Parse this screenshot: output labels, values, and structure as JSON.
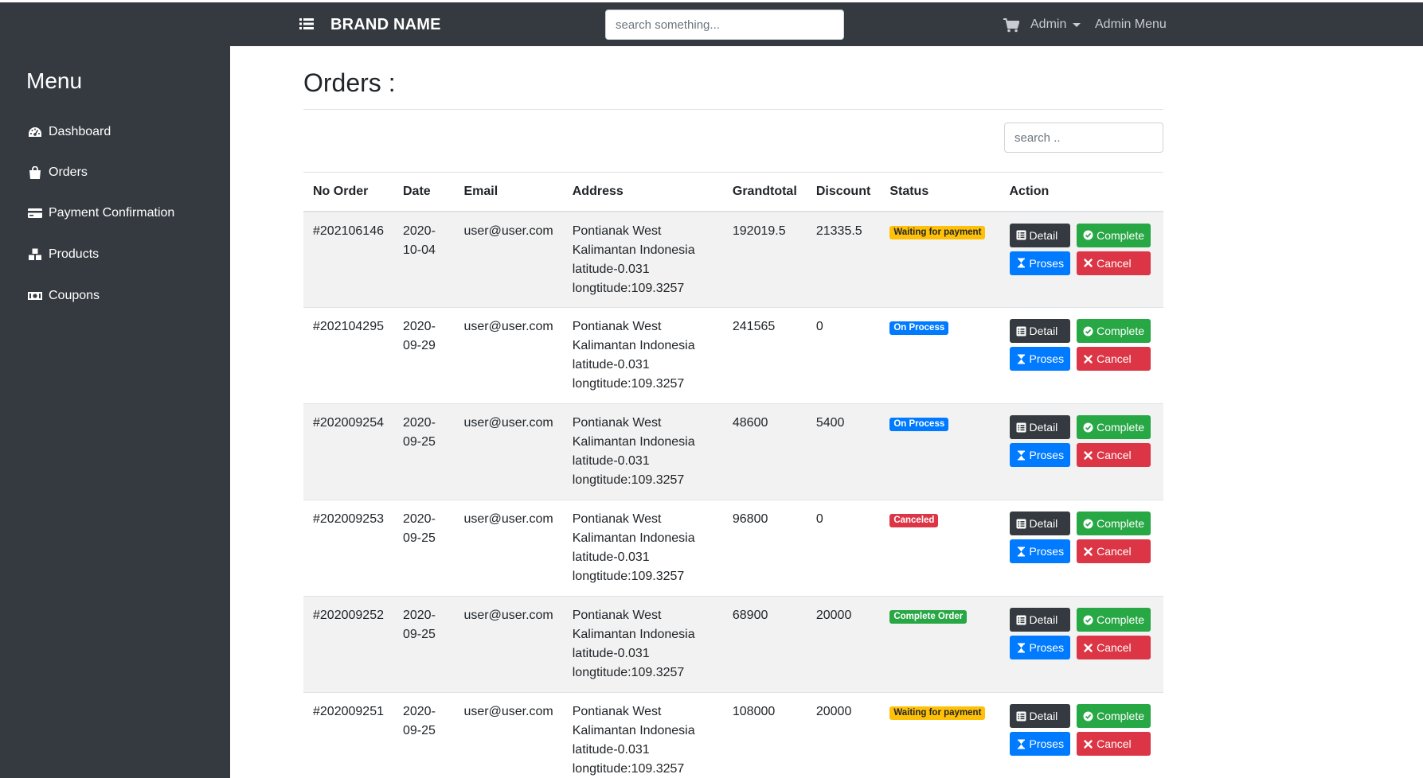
{
  "navbar": {
    "brand": "BRAND NAME",
    "search_placeholder": "search something...",
    "admin_label": "Admin",
    "admin_menu_label": "Admin Menu"
  },
  "sidebar": {
    "title": "Menu",
    "items": [
      {
        "label": "Dashboard",
        "icon": "tachometer-icon"
      },
      {
        "label": "Orders",
        "icon": "shopping-bag-icon"
      },
      {
        "label": "Payment Confirmation",
        "icon": "credit-card-icon"
      },
      {
        "label": "Products",
        "icon": "cubes-icon"
      },
      {
        "label": "Coupons",
        "icon": "money-bill-icon"
      }
    ]
  },
  "page": {
    "title": "Orders :",
    "search_placeholder": "search .."
  },
  "table": {
    "headers": [
      "No Order",
      "Date",
      "Email",
      "Address",
      "Grandtotal",
      "Discount",
      "Status",
      "Action"
    ],
    "actions": {
      "detail": "Detail",
      "complete": "Complete",
      "proses": "Proses",
      "cancel": "Cancel"
    },
    "rows": [
      {
        "no": "#202106146",
        "date": "2020-10-04",
        "email": "user@user.com",
        "addr1": "Pontianak West",
        "addr2": "Kalimantan Indonesia",
        "addr3": "latitude-0.031",
        "addr4": "longtitude:109.3257",
        "total": "192019.5",
        "discount": "21335.5",
        "status": "Waiting for payment"
      },
      {
        "no": "#202104295",
        "date": "2020-09-29",
        "email": "user@user.com",
        "addr1": "Pontianak West",
        "addr2": "Kalimantan Indonesia",
        "addr3": "latitude-0.031",
        "addr4": "longtitude:109.3257",
        "total": "241565",
        "discount": "0",
        "status": "On Process"
      },
      {
        "no": "#202009254",
        "date": "2020-09-25",
        "email": "user@user.com",
        "addr1": "Pontianak West",
        "addr2": "Kalimantan Indonesia",
        "addr3": "latitude-0.031",
        "addr4": "longtitude:109.3257",
        "total": "48600",
        "discount": "5400",
        "status": "On Process"
      },
      {
        "no": "#202009253",
        "date": "2020-09-25",
        "email": "user@user.com",
        "addr1": "Pontianak West",
        "addr2": "Kalimantan Indonesia",
        "addr3": "latitude-0.031",
        "addr4": "longtitude:109.3257",
        "total": "96800",
        "discount": "0",
        "status": "Canceled"
      },
      {
        "no": "#202009252",
        "date": "2020-09-25",
        "email": "user@user.com",
        "addr1": "Pontianak West",
        "addr2": "Kalimantan Indonesia",
        "addr3": "latitude-0.031",
        "addr4": "longtitude:109.3257",
        "total": "68900",
        "discount": "20000",
        "status": "Complete Order"
      },
      {
        "no": "#202009251",
        "date": "2020-09-25",
        "email": "user@user.com",
        "addr1": "Pontianak West",
        "addr2": "Kalimantan Indonesia",
        "addr3": "latitude-0.031",
        "addr4": "longtitude:109.3257",
        "total": "108000",
        "discount": "20000",
        "status": "Waiting for payment"
      }
    ]
  },
  "status_colors": {
    "Waiting for payment": "#ffc107",
    "On Process": "#007bff",
    "Canceled": "#dc3545",
    "Complete Order": "#28a745"
  }
}
